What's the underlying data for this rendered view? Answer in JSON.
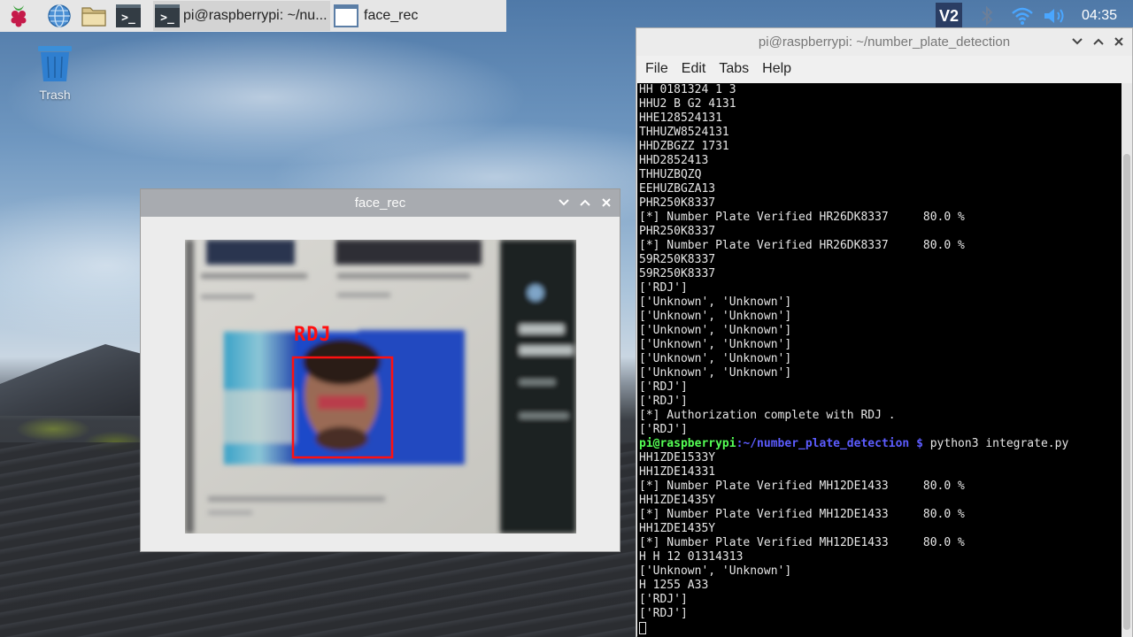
{
  "colors": {
    "taskbar_bg": "#e6e6e6",
    "terminal_bg": "#000000",
    "terminal_text": "#e6e6e6",
    "prompt_user": "#55ff55",
    "prompt_path": "#5c5cff",
    "detection_box": "#ff1010"
  },
  "taskbar": {
    "launchers": [
      {
        "name": "raspberry-menu-icon"
      },
      {
        "name": "web-browser-icon"
      },
      {
        "name": "file-manager-icon"
      },
      {
        "name": "terminal-launcher-icon"
      }
    ],
    "tasks": [
      {
        "label": "pi@raspberrypi: ~/nu...",
        "active": true,
        "icon": "terminal-icon"
      },
      {
        "label": "face_rec",
        "active": false,
        "icon": "window-icon"
      }
    ],
    "tray": {
      "icons": [
        "vnc-icon",
        "bluetooth-icon",
        "wifi-icon",
        "volume-icon"
      ],
      "clock": "04:35"
    }
  },
  "desktop": {
    "trash_label": "Trash"
  },
  "face_window": {
    "title": "face_rec",
    "detection_label": "RDJ",
    "blurred_captions": [
      "Robert Downey Jr.'s In...",
      "Robert Downey Jr. Wants Fa...",
      "After Iron Man, Robert Downey Jr. wins..."
    ]
  },
  "terminal_window": {
    "title": "pi@raspberrypi: ~/number_plate_detection",
    "menu": [
      "File",
      "Edit",
      "Tabs",
      "Help"
    ],
    "prompt": {
      "user": "pi@raspberrypi",
      "path": ":~/number_plate_detection $",
      "command": " python3 integrate.py"
    },
    "lines_before": [
      "HH 0181324 1 3",
      "HHU2 B G2 4131",
      "HHE128524131",
      "THHUZW8524131",
      "HHDZBGZZ 1731",
      "HHD2852413",
      "THHUZBQZQ",
      "EEHUZBGZA13",
      "PHR250K8337",
      "[*] Number Plate Verified HR26DK8337     80.0 %",
      "PHR250K8337",
      "[*] Number Plate Verified HR26DK8337     80.0 %",
      "59R250K8337",
      "59R250K8337",
      "['RDJ']",
      "['Unknown', 'Unknown']",
      "['Unknown', 'Unknown']",
      "['Unknown', 'Unknown']",
      "['Unknown', 'Unknown']",
      "['Unknown', 'Unknown']",
      "['Unknown', 'Unknown']",
      "['RDJ']",
      "['RDJ']",
      "[*] Authorization complete with RDJ .",
      "['RDJ']"
    ],
    "lines_after": [
      "HH1ZDE1533Y",
      "HH1ZDE14331",
      "[*] Number Plate Verified MH12DE1433     80.0 %",
      "HH1ZDE1435Y",
      "[*] Number Plate Verified MH12DE1433     80.0 %",
      "HH1ZDE1435Y",
      "[*] Number Plate Verified MH12DE1433     80.0 %",
      "H H 12 01314313",
      "['Unknown', 'Unknown']",
      "H 1255 A33",
      "['RDJ']",
      "['RDJ']"
    ]
  }
}
